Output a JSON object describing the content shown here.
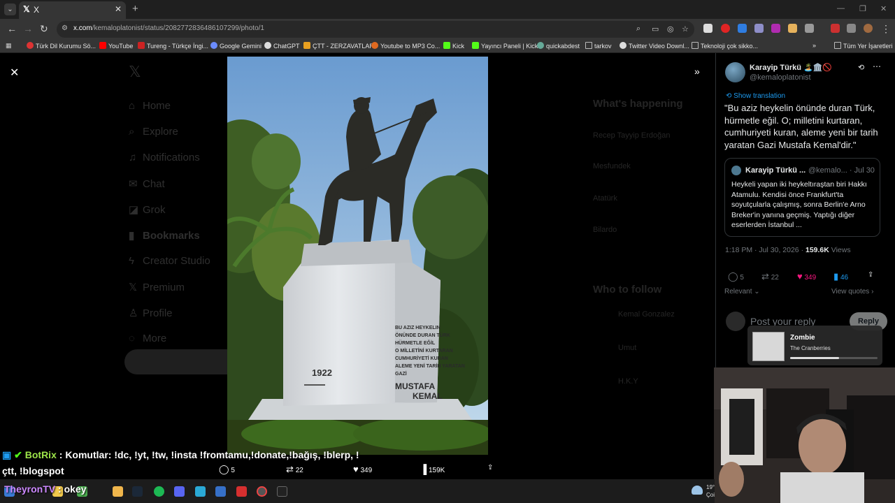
{
  "browser": {
    "tab_title": "X",
    "tab_icon": "𝕏",
    "url_domain": "x.com",
    "url_path": "/kemaloplatonist/status/2082772836486107299/photo/1",
    "bookmarks": [
      {
        "label": "Türk Dil Kurumu Sö...",
        "color": "#d33"
      },
      {
        "label": "YouTube",
        "color": "#f00"
      },
      {
        "label": "Tureng - Türkçe İngi...",
        "color": "#c22"
      },
      {
        "label": "Google Gemini",
        "color": "#6b8cff"
      },
      {
        "label": "ChatGPT",
        "color": "#ddd"
      },
      {
        "label": "ÇTT - ZERZAVATLAR",
        "color": "#e8a020"
      },
      {
        "label": "Youtube to MP3 Co...",
        "color": "#e06a20"
      },
      {
        "label": "Kick",
        "color": "#53fc18"
      },
      {
        "label": "Yayıncı Paneli | Kick",
        "color": "#53fc18"
      },
      {
        "label": "quickabdest",
        "color": "#6a9"
      },
      {
        "label": "tarkov",
        "color": "#888"
      },
      {
        "label": "Twitter Video Downl...",
        "color": "#ddd"
      },
      {
        "label": "Teknoloji çok sikko...",
        "color": "#888"
      }
    ],
    "bookmarks_overflow": "»",
    "all_bookmarks": "Tüm Yer İşaretleri"
  },
  "background_nav": [
    "Home",
    "Explore",
    "Notifications",
    "Chat",
    "Grok",
    "Bookmarks",
    "Creator Studio",
    "Premium",
    "Profile",
    "More"
  ],
  "background_post": "Post",
  "background_right": {
    "heading": "What's happening",
    "items": [
      "Recep Tayyip Erdoğan",
      "Mesfundek",
      "Atatürk",
      "Bilardo"
    ],
    "follow_heading": "Who to follow",
    "follow": [
      "Kemal Gonzalez",
      "Umut",
      "H.K.Y"
    ]
  },
  "tweet": {
    "author": "Karayip Türkü 🏝️🏛️🚫",
    "handle": "@kemaloplatonist",
    "show_translation": "Show translation",
    "text": "\"Bu aziz heykelin önünde duran Türk, hürmetle eğil. O; milletini kurtaran, cumhuriyeti kuran, aleme yeni bir tarih yaratan Gazi Mustafa Kemal'dir.\"",
    "quote": {
      "author": "Karayip Türkü ...",
      "meta": "@kemalo... · Jul 30",
      "text": "Heykeli yapan iki heykeltıraştan biri Hakkı Atamulu. Kendisi önce Frankfurt'ta soyutçularla çalışmış, sonra Berlin'e Arno Breker'in yanına geçmiş. Yaptığı diğer eserlerden İstanbul ..."
    },
    "time": "1:18 PM · Jul 30, 2026 · ",
    "views_count": "159.6K",
    "views_label": " Views",
    "replies": "5",
    "reposts": "22",
    "likes": "349",
    "bookmarks": "46",
    "sort": "Relevant ⌄",
    "view_quotes": "View quotes ›",
    "reply_placeholder": "Post your reply",
    "reply_button": "Reply"
  },
  "photo_bar": {
    "replies": "5",
    "reposts": "22",
    "likes": "349",
    "views": "159K"
  },
  "statue": {
    "inscription_lines": [
      "BU AZIZ HEYKELIN",
      "ÖNÜNDE DURAN TÜRK",
      "HÜRMETLE EĞİL",
      "O MİLLETİNİ KURTARAN",
      "CUMHURİYETİ KURAN",
      "ALEME YENİ TARİH YARATAN",
      "GAZİ"
    ],
    "name_top": "MUSTAFA",
    "name_bottom": "KEMAL",
    "year": "1922"
  },
  "music": {
    "song": "Zombie",
    "artist": "The Cranberries",
    "progress": 0.56
  },
  "chat": {
    "bot_name": "BotRix",
    "bot_message": " : Komutlar: !dc, !yt, !tw, !insta !fromtamu,!donate,!bağış, !blerp, !",
    "bot_message_2": "çtt, !blogspot",
    "user_name": "TheyronTV",
    "user_message": " : okey"
  },
  "taskbar": {
    "temp": "19°",
    "day": "Çoi"
  }
}
